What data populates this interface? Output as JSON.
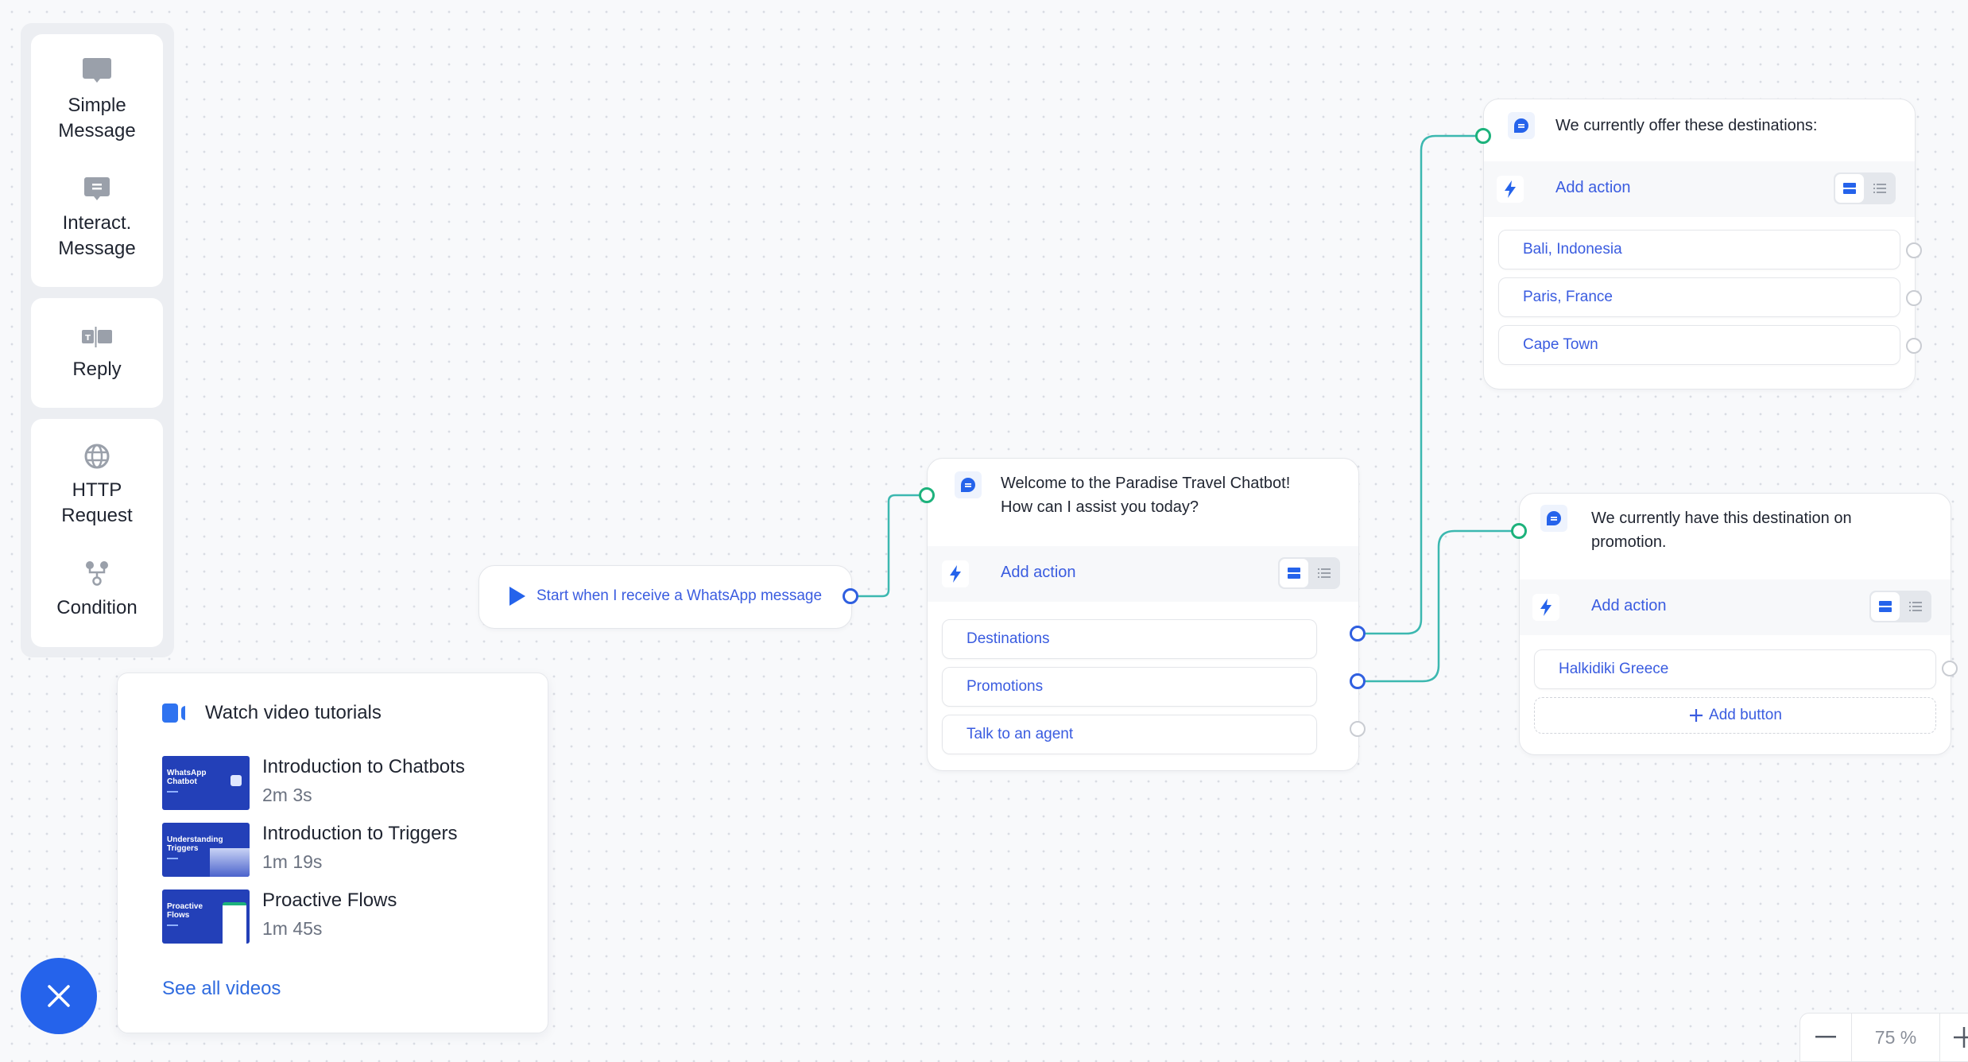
{
  "palette": {
    "groups": [
      {
        "items": [
          {
            "label": "Simple Message",
            "icon": "simple-message-icon"
          },
          {
            "label": "Interact. Message",
            "icon": "interactive-message-icon"
          }
        ]
      },
      {
        "items": [
          {
            "label": "Reply",
            "icon": "reply-icon"
          }
        ]
      },
      {
        "items": [
          {
            "label": "HTTP Request",
            "icon": "globe-icon"
          },
          {
            "label": "Condition",
            "icon": "condition-branch-icon"
          }
        ]
      }
    ]
  },
  "tutorials": {
    "title": "Watch video tutorials",
    "videos": [
      {
        "title": "Introduction to Chatbots",
        "duration": "2m 3s",
        "thumb_text": "WhatsApp Chatbot"
      },
      {
        "title": "Introduction to Triggers",
        "duration": "1m 19s",
        "thumb_text": "Understanding Triggers"
      },
      {
        "title": "Proactive Flows",
        "duration": "1m 45s",
        "thumb_text": "Proactive Flows"
      }
    ],
    "see_all": "See all videos"
  },
  "flow": {
    "start": {
      "label": "Start when I receive a WhatsApp message"
    },
    "welcome": {
      "message_line1": "Welcome to the Paradise Travel Chatbot!",
      "message_line2": "How can I assist you today?",
      "add_action": "Add action",
      "buttons": [
        "Destinations",
        "Promotions",
        "Talk to an agent"
      ]
    },
    "destinations": {
      "message": "We currently offer these destinations:",
      "add_action": "Add action",
      "buttons": [
        "Bali, Indonesia",
        "Paris, France",
        "Cape Town"
      ]
    },
    "promotion": {
      "message_line1": "We currently have this destination on",
      "message_line2": "promotion.",
      "add_action": "Add action",
      "buttons": [
        "Halkidiki Greece"
      ],
      "add_button": "Add button"
    }
  },
  "zoom": {
    "value": "75 %",
    "minus": "−",
    "plus": "+"
  },
  "colors": {
    "accent": "#2563eb",
    "link": "#3a5ce0",
    "connector": "#3cb8b0",
    "port_target": "#1db27c"
  }
}
